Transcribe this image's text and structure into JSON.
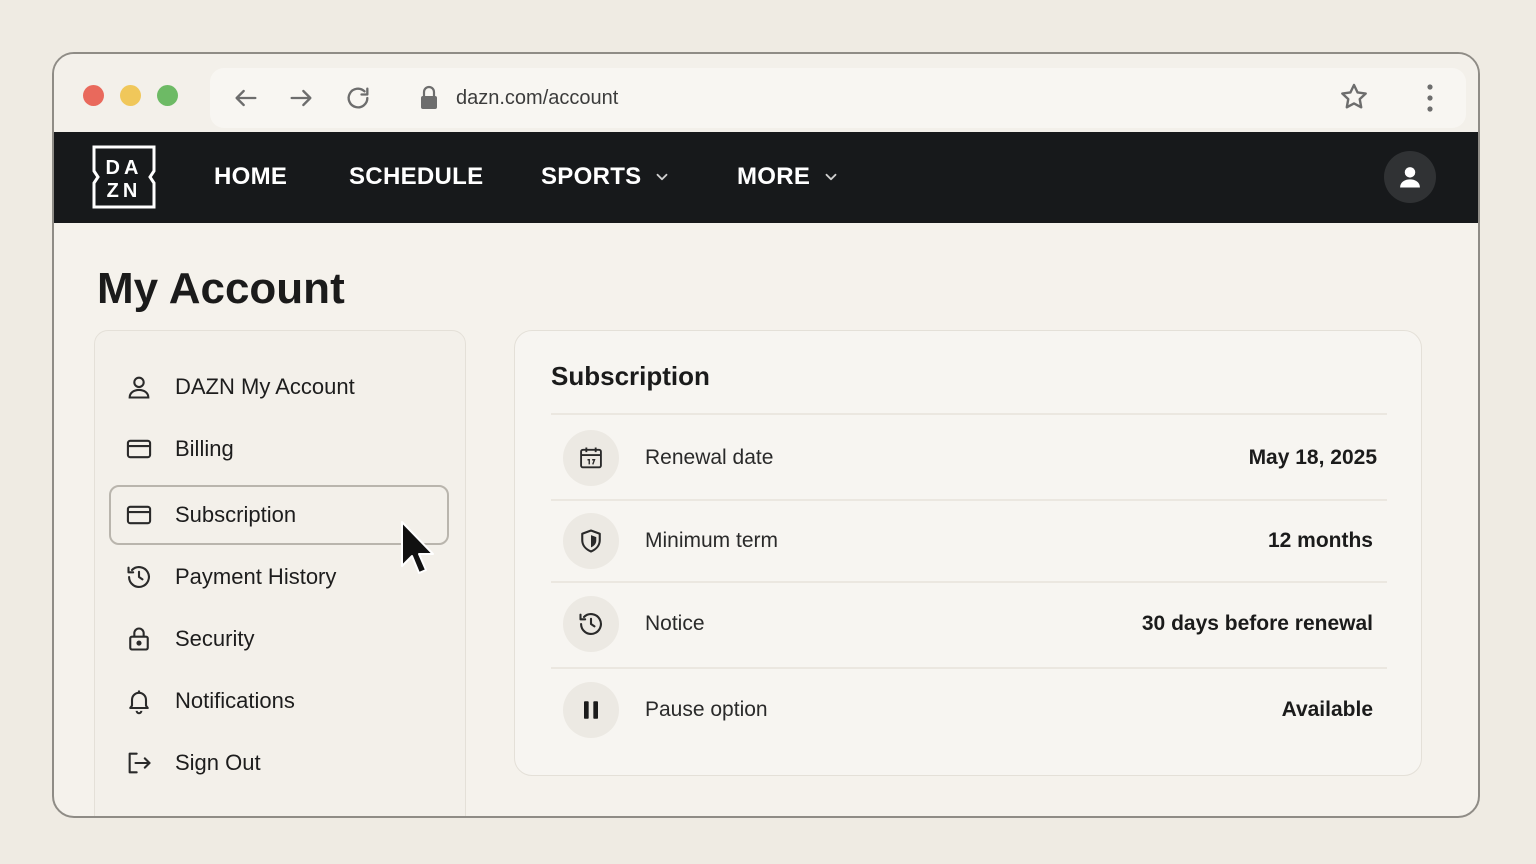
{
  "browser": {
    "url": "dazn.com/account"
  },
  "nav": {
    "logo_line1": "DA",
    "logo_line2": "ZN",
    "items": [
      {
        "label": "HOME"
      },
      {
        "label": "SCHEDULE"
      },
      {
        "label": "SPORTS"
      },
      {
        "label": "MORE"
      }
    ]
  },
  "page": {
    "title": "My Account"
  },
  "sidebar": {
    "items": [
      {
        "label": "DAZN My Account",
        "icon": "user-icon"
      },
      {
        "label": "Billing",
        "icon": "credit-card-icon"
      },
      {
        "label": "Subscription",
        "icon": "credit-card-icon",
        "active": true
      },
      {
        "label": "Payment History",
        "icon": "history-icon"
      },
      {
        "label": "Security",
        "icon": "lock-icon"
      },
      {
        "label": "Notifications",
        "icon": "bell-icon"
      },
      {
        "label": "Sign Out",
        "icon": "sign-out-icon"
      }
    ]
  },
  "subscription": {
    "title": "Subscription",
    "rows": [
      {
        "label": "Renewal date",
        "value": "May 18, 2025",
        "icon": "calendar-icon"
      },
      {
        "label": "Minimum term",
        "value": "12 months",
        "icon": "shield-icon"
      },
      {
        "label": "Notice",
        "value": "30 days before renewal",
        "icon": "clock-icon"
      },
      {
        "label": "Pause option",
        "value": "Available",
        "icon": "pause-icon"
      }
    ]
  },
  "colors": {
    "nav_bg": "#17191b",
    "page_bg": "#f5f2ec",
    "accent_dot_red": "#e9695c",
    "accent_dot_yellow": "#f0c75a",
    "accent_dot_green": "#6dba65"
  }
}
